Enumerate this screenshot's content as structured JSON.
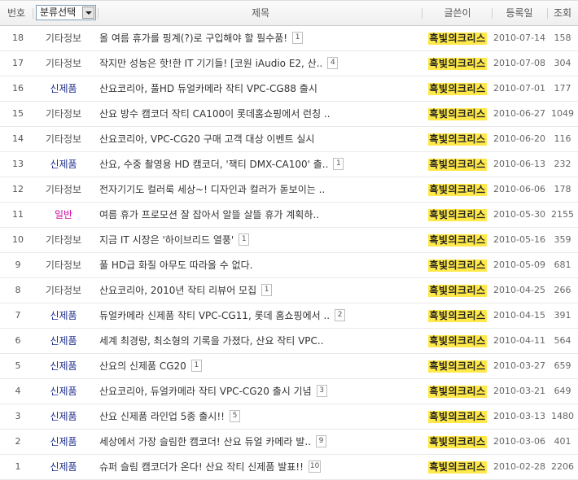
{
  "header": {
    "number": "번호",
    "category_select": "분류선택",
    "title": "제목",
    "author": "글쓴이",
    "date": "등록일",
    "views": "조회"
  },
  "rows": [
    {
      "no": "18",
      "category": "기타정보",
      "cat_type": "info",
      "title": "올 여름 휴가를 핑계(?)로 구입해야 할 필수품!",
      "comments": "1",
      "author": "흑빛의크리스",
      "date": "2010-07-14",
      "views": "158"
    },
    {
      "no": "17",
      "category": "기타정보",
      "cat_type": "info",
      "title": "작지만 성능은 핫!한 IT 기기들! [코원 iAudio E2, 산..",
      "comments": "4",
      "author": "흑빛의크리스",
      "date": "2010-07-08",
      "views": "304"
    },
    {
      "no": "16",
      "category": "신제품",
      "cat_type": "new",
      "title": "산요코리아, 풀HD 듀얼카메라 작티 VPC-CG88 출시",
      "comments": "",
      "author": "흑빛의크리스",
      "date": "2010-07-01",
      "views": "177"
    },
    {
      "no": "15",
      "category": "기타정보",
      "cat_type": "info",
      "title": "산요 방수 캠코더 작티 CA100이 롯데홈쇼핑에서 런칭 ..",
      "comments": "",
      "author": "흑빛의크리스",
      "date": "2010-06-27",
      "views": "1049"
    },
    {
      "no": "14",
      "category": "기타정보",
      "cat_type": "info",
      "title": "산요코리아, VPC-CG20 구매 고객 대상 이벤트 실시",
      "comments": "",
      "author": "흑빛의크리스",
      "date": "2010-06-20",
      "views": "116"
    },
    {
      "no": "13",
      "category": "신제품",
      "cat_type": "new",
      "title": "산요, 수중 촬영용 HD 캠코더, '잭티 DMX-CA100' 출..",
      "comments": "1",
      "author": "흑빛의크리스",
      "date": "2010-06-13",
      "views": "232"
    },
    {
      "no": "12",
      "category": "기타정보",
      "cat_type": "info",
      "title": "전자기기도 컬러룩 세상~! 디자인과 컬러가 돋보이는 ..",
      "comments": "",
      "author": "흑빛의크리스",
      "date": "2010-06-06",
      "views": "178"
    },
    {
      "no": "11",
      "category": "일반",
      "cat_type": "gen",
      "title": "여름 휴가 프로모션 잘 잡아서 알뜰 살뜰 휴가 계획하..",
      "comments": "",
      "author": "흑빛의크리스",
      "date": "2010-05-30",
      "views": "2155"
    },
    {
      "no": "10",
      "category": "기타정보",
      "cat_type": "info",
      "title": "지금 IT 시장은 '하이브리드 열풍'",
      "comments": "1",
      "author": "흑빛의크리스",
      "date": "2010-05-16",
      "views": "359"
    },
    {
      "no": "9",
      "category": "기타정보",
      "cat_type": "info",
      "title": "풀 HD급 화질 아무도 따라올 수 없다.",
      "comments": "",
      "author": "흑빛의크리스",
      "date": "2010-05-09",
      "views": "681"
    },
    {
      "no": "8",
      "category": "기타정보",
      "cat_type": "info",
      "title": "산요코리아, 2010년 작티 리뷰어 모집",
      "comments": "1",
      "author": "흑빛의크리스",
      "date": "2010-04-25",
      "views": "266"
    },
    {
      "no": "7",
      "category": "신제품",
      "cat_type": "new",
      "title": "듀얼카메라 신제품 작티 VPC-CG11, 롯데 홈쇼핑에서 ..",
      "comments": "2",
      "author": "흑빛의크리스",
      "date": "2010-04-15",
      "views": "391"
    },
    {
      "no": "6",
      "category": "신제품",
      "cat_type": "new",
      "title": "세계 최경량, 최소형의 기록을 가졌다, 산요 작티 VPC..",
      "comments": "",
      "author": "흑빛의크리스",
      "date": "2010-04-11",
      "views": "564"
    },
    {
      "no": "5",
      "category": "신제품",
      "cat_type": "new",
      "title": "산요의 신제품 CG20",
      "comments": "1",
      "author": "흑빛의크리스",
      "date": "2010-03-27",
      "views": "659"
    },
    {
      "no": "4",
      "category": "신제품",
      "cat_type": "new",
      "title": "산요코리아, 듀얼카메라 작티 VPC-CG20 출시 기념",
      "comments": "3",
      "author": "흑빛의크리스",
      "date": "2010-03-21",
      "views": "649"
    },
    {
      "no": "3",
      "category": "신제품",
      "cat_type": "new",
      "title": "산요 신제품 라인업 5종 출시!!",
      "comments": "5",
      "author": "흑빛의크리스",
      "date": "2010-03-13",
      "views": "1480"
    },
    {
      "no": "2",
      "category": "신제품",
      "cat_type": "new",
      "title": "세상에서 가장 슬림한 캠코더! 산요 듀얼 카메라 발..",
      "comments": "9",
      "author": "흑빛의크리스",
      "date": "2010-03-06",
      "views": "401"
    },
    {
      "no": "1",
      "category": "신제품",
      "cat_type": "new",
      "title": "슈퍼 슬림 캠코더가 온다! 산요 작티 신제품 발표!!",
      "comments": "10",
      "author": "흑빛의크리스",
      "date": "2010-02-28",
      "views": "2206"
    }
  ]
}
